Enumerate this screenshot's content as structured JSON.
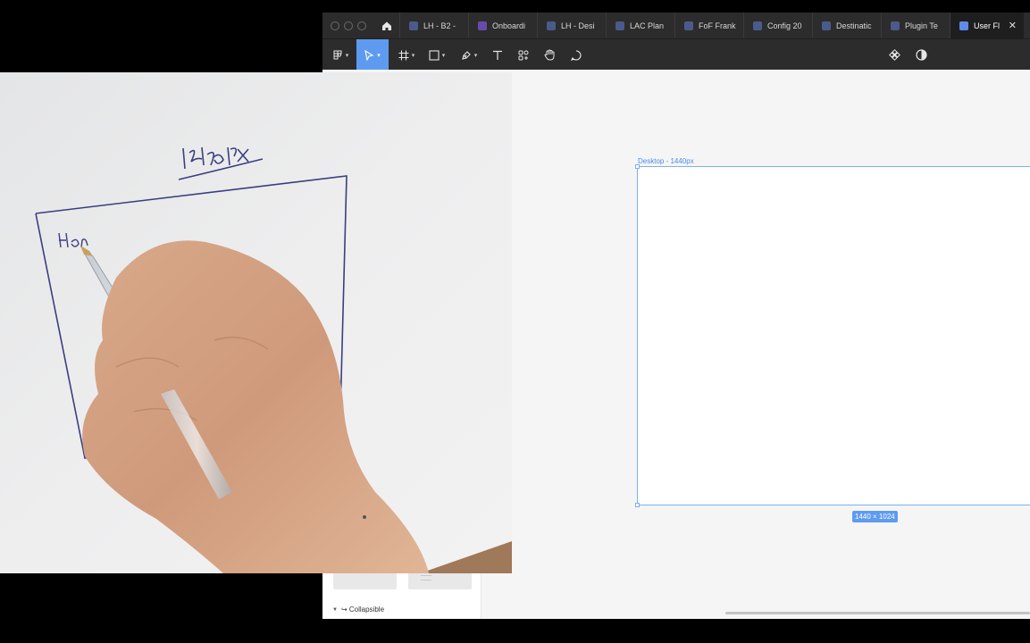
{
  "tabs": [
    {
      "label": "LH - B2 -",
      "icon": "figma-file-icon"
    },
    {
      "label": "Onboardi",
      "icon": "figma-file-icon",
      "accent": "#6a4aa8"
    },
    {
      "label": "LH - Desi",
      "icon": "figma-file-icon"
    },
    {
      "label": "LAC Plan",
      "icon": "figma-file-icon"
    },
    {
      "label": "FoF Frank",
      "icon": "figma-file-icon"
    },
    {
      "label": "Config 20",
      "icon": "figma-file-icon"
    },
    {
      "label": "Destinatic",
      "icon": "figma-file-icon"
    },
    {
      "label": "Plugin Te",
      "icon": "figma-file-icon"
    },
    {
      "label": "User Fl",
      "icon": "figma-file-icon",
      "active": true
    }
  ],
  "toolbar": {
    "tools": [
      "main-menu",
      "move",
      "frame",
      "shape",
      "pen",
      "text",
      "resources",
      "hand",
      "comment"
    ],
    "active_tool": "move",
    "right_tools": [
      "components",
      "dark-mode"
    ]
  },
  "canvas": {
    "frame_label": "Desktop - 1440px",
    "dimensions": "1440 × 1024"
  },
  "left_panel": {
    "collapsible_label": "↪ Collapsible"
  },
  "photo": {
    "handwritten_width": "1440 px",
    "handwritten_label": "Home"
  },
  "colors": {
    "accent": "#5e9bf0",
    "selection": "#7db0f0",
    "chrome": "#2c2c2c"
  }
}
